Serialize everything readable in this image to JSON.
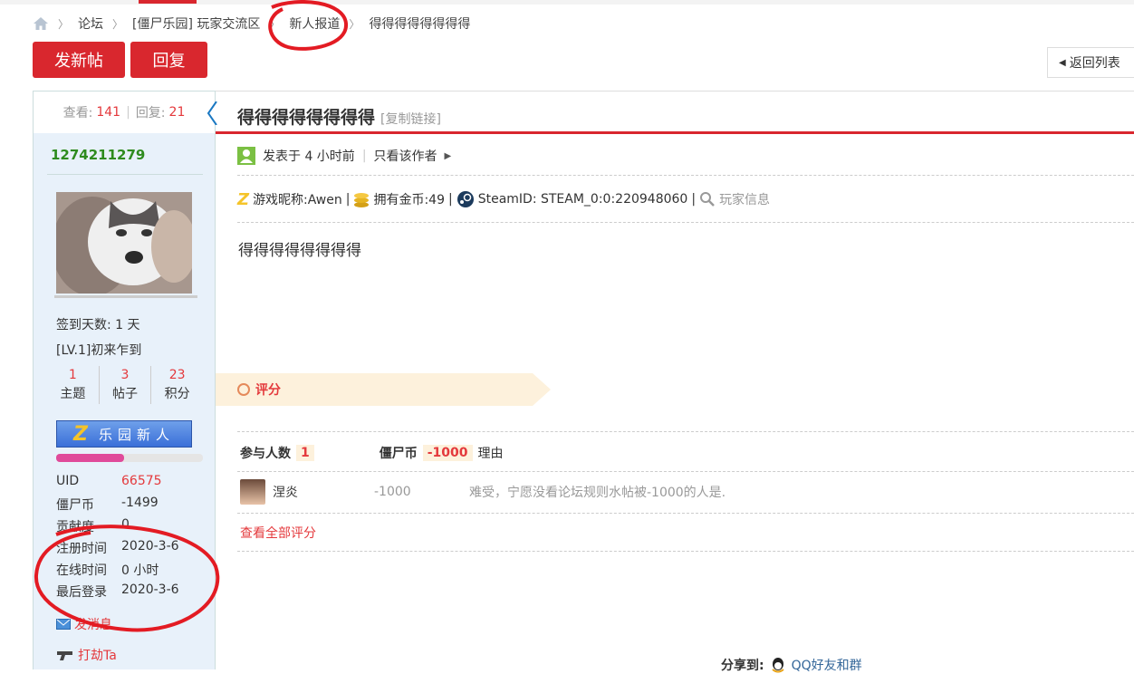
{
  "breadcrumb": {
    "items": [
      "论坛",
      "[僵尸乐园] 玩家交流区",
      "新人报道",
      "得得得得得得得得"
    ]
  },
  "toolbar": {
    "new_post": "发新帖",
    "reply": "回复",
    "back_to_list": "返回列表"
  },
  "thread_stats": {
    "views_label": "查看:",
    "views": "141",
    "replies_label": "回复:",
    "replies": "21"
  },
  "author": {
    "name": "1274211279",
    "sign_days": "签到天数: 1 天",
    "level": "[LV.1]初来乍到",
    "counts": [
      {
        "value": "1",
        "label": "主题"
      },
      {
        "value": "3",
        "label": "帖子"
      },
      {
        "value": "23",
        "label": "积分"
      }
    ],
    "badge_text": "乐园新人",
    "badge_letter": "Z",
    "level_progress": 0.46,
    "fields": [
      {
        "k": "UID",
        "v": "66575"
      },
      {
        "k": "僵尸币",
        "v": "-1499"
      },
      {
        "k": "贡献度",
        "v": "0"
      },
      {
        "k": "注册时间",
        "v": "2020-3-6"
      },
      {
        "k": "在线时间",
        "v": "0 小时"
      },
      {
        "k": "最后登录",
        "v": "2020-3-6"
      }
    ],
    "send_message": "发消息",
    "rob": "打劫Ta"
  },
  "post": {
    "title": "得得得得得得得得",
    "copy_link": "[复制链接]",
    "posted": "发表于 4 小时前",
    "only_author": "只看该作者",
    "game_nick": "游戏昵称:Awen",
    "gold": "拥有金币:49",
    "steam": "SteamID: STEAM_0:0:220948060",
    "player_info": "玩家信息",
    "content": "得得得得得得得得"
  },
  "rating": {
    "section_label": "评分",
    "participants_label": "参与人数",
    "participants": "1",
    "currency_label": "僵尸币",
    "currency_total": "-1000",
    "reason_label": "理由",
    "rows": [
      {
        "user": "涅炎",
        "value": "-1000",
        "reason": "难受，宁愿没看论坛规则水帖被-1000的人是."
      }
    ],
    "view_all": "查看全部评分"
  },
  "share": {
    "label": "分享到:",
    "qq": "QQ好友和群"
  },
  "colors": {
    "accent": "#d9272e",
    "green_name": "#2e8b1e",
    "sidebar_bg": "#e8f1fa"
  }
}
